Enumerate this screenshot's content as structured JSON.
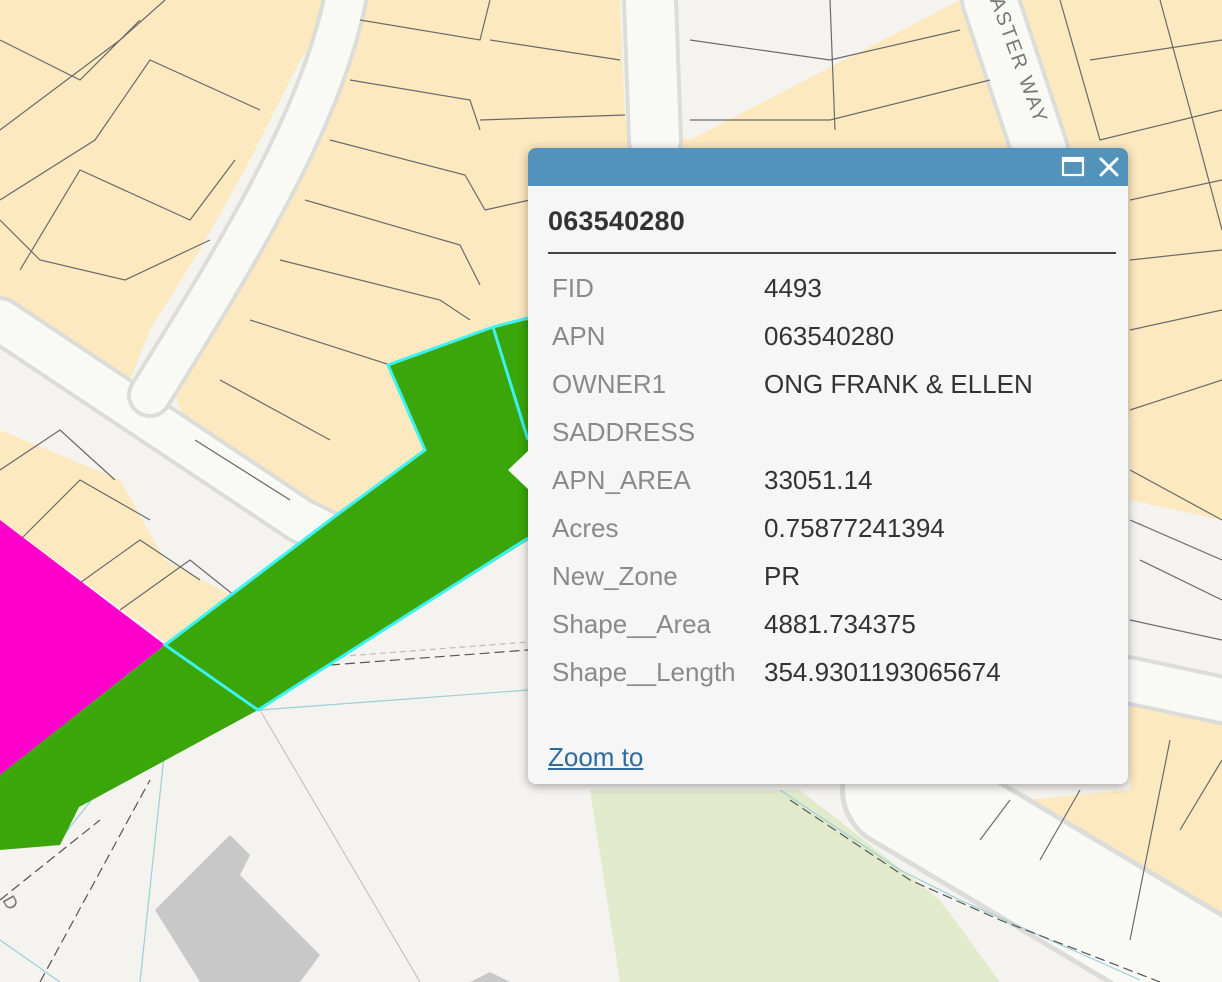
{
  "map": {
    "street_label": "ASTER WAY",
    "colors": {
      "parcel_fill": "#fde9bf",
      "parcel_line": "#6a6a6a",
      "road": "#f9f9f6",
      "road_edge": "#dcdcd8",
      "selected_parcel": "#3aa60a",
      "selection_outline": "#3df2f2",
      "zone_magenta": "#ff00cc",
      "park": "#e1ebcb",
      "building": "#c8c8c8"
    }
  },
  "popup": {
    "title": "063540280",
    "header_color": "#5393bb",
    "maximize_icon": "maximize-icon",
    "close_icon": "close-icon",
    "attributes": [
      {
        "key": "FID",
        "value": "4493"
      },
      {
        "key": "APN",
        "value": "063540280"
      },
      {
        "key": "OWNER1",
        "value": "ONG FRANK & ELLEN"
      },
      {
        "key": "SADDRESS",
        "value": ""
      },
      {
        "key": "APN_AREA",
        "value": "33051.14"
      },
      {
        "key": "Acres",
        "value": "0.75877241394"
      },
      {
        "key": "New_Zone",
        "value": "PR"
      },
      {
        "key": "Shape__Area",
        "value": "4881.734375"
      },
      {
        "key": "Shape__Length",
        "value": "354.9301193065674"
      }
    ],
    "zoom_label": "Zoom to"
  }
}
